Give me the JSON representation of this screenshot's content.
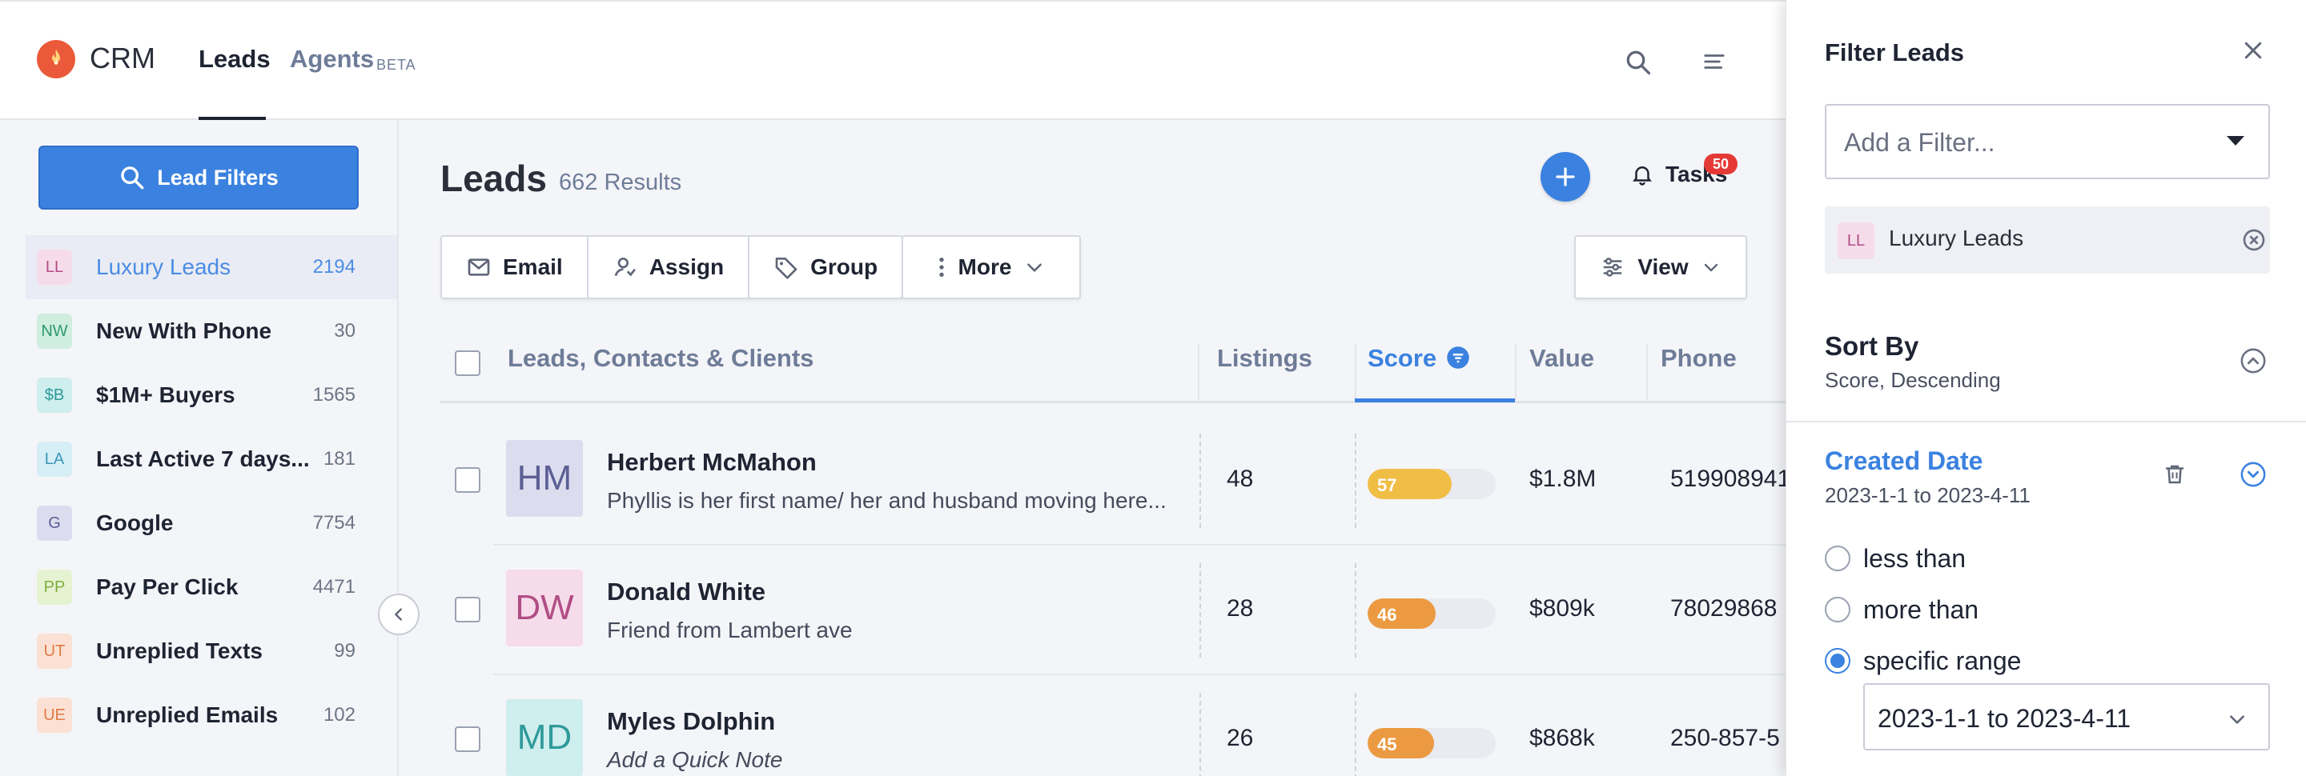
{
  "header": {
    "brand": "CRM",
    "nav": [
      {
        "label": "Leads",
        "active": true
      },
      {
        "label": "Agents",
        "badge": "BETA"
      }
    ]
  },
  "sidebar": {
    "lead_filters_label": "Lead Filters",
    "items": [
      {
        "badge": "LL",
        "label": "Luxury Leads",
        "count": "2194",
        "badge_bg": "#f6dcea",
        "badge_fg": "#b14d85",
        "active": true
      },
      {
        "badge": "NW",
        "label": "New With Phone",
        "count": "30",
        "badge_bg": "#cfeee0",
        "badge_fg": "#2f9a6a"
      },
      {
        "badge": "$B",
        "label": "$1M+ Buyers",
        "count": "1565",
        "badge_bg": "#cfeeee",
        "badge_fg": "#2f9a9a"
      },
      {
        "badge": "LA",
        "label": "Last Active 7 days...",
        "count": "181",
        "badge_bg": "#d6eef6",
        "badge_fg": "#3a98b8"
      },
      {
        "badge": "G",
        "label": "Google",
        "count": "7754",
        "badge_bg": "#dcdcef",
        "badge_fg": "#5b5f94"
      },
      {
        "badge": "PP",
        "label": "Pay Per Click",
        "count": "4471",
        "badge_bg": "#e6f3d3",
        "badge_fg": "#7fae3d"
      },
      {
        "badge": "UT",
        "label": "Unreplied Texts",
        "count": "99",
        "badge_bg": "#fbe1d3",
        "badge_fg": "#e07a45"
      },
      {
        "badge": "UE",
        "label": "Unreplied Emails",
        "count": "102",
        "badge_bg": "#fbe1d3",
        "badge_fg": "#e07a45"
      }
    ]
  },
  "main": {
    "title": "Leads",
    "results": "662 Results",
    "tasks_label": "Tasks",
    "tasks_count": "50",
    "actions": {
      "email": "Email",
      "assign": "Assign",
      "group": "Group",
      "more": "More",
      "view": "View"
    },
    "columns": {
      "leads": "Leads, Contacts & Clients",
      "listings": "Listings",
      "score": "Score",
      "value": "Value",
      "phone": "Phone"
    },
    "rows": [
      {
        "initials": "HM",
        "name": "Herbert McMahon",
        "note": "Phyllis is her first name/ her and husband moving here...",
        "note_italic": false,
        "listings": "48",
        "score": "57",
        "score_pct": 0.57,
        "score_color": "#f0bd45",
        "value": "$1.8M",
        "phone": "519908941",
        "avatar_bg": "#dcdcef",
        "avatar_fg": "#5b5f94"
      },
      {
        "initials": "DW",
        "name": "Donald White",
        "note": "Friend from Lambert ave",
        "note_italic": false,
        "listings": "28",
        "score": "46",
        "score_pct": 0.46,
        "score_color": "#eb9a42",
        "value": "$809k",
        "phone": "78029868",
        "avatar_bg": "#f6dcea",
        "avatar_fg": "#b14d85"
      },
      {
        "initials": "MD",
        "name": "Myles Dolphin",
        "note": "Add a Quick Note",
        "note_italic": true,
        "listings": "26",
        "score": "45",
        "score_pct": 0.45,
        "score_color": "#eb9a42",
        "value": "$868k",
        "phone": "250-857-5",
        "avatar_bg": "#cfeeee",
        "avatar_fg": "#2f9a9a"
      }
    ]
  },
  "panel": {
    "title": "Filter Leads",
    "add_filter_placeholder": "Add a Filter...",
    "chip": {
      "badge": "LL",
      "label": "Luxury Leads"
    },
    "sort_title": "Sort By",
    "sort_value": "Score, Descending",
    "created_title": "Created Date",
    "created_value": "2023-1-1 to 2023-4-11",
    "options": [
      {
        "label": "less than",
        "selected": false
      },
      {
        "label": "more than",
        "selected": false
      },
      {
        "label": "specific range",
        "selected": true
      }
    ],
    "range_value": "2023-1-1 to 2023-4-11"
  },
  "colors": {
    "accent": "#3b82e0",
    "badge_red": "#e53935"
  }
}
